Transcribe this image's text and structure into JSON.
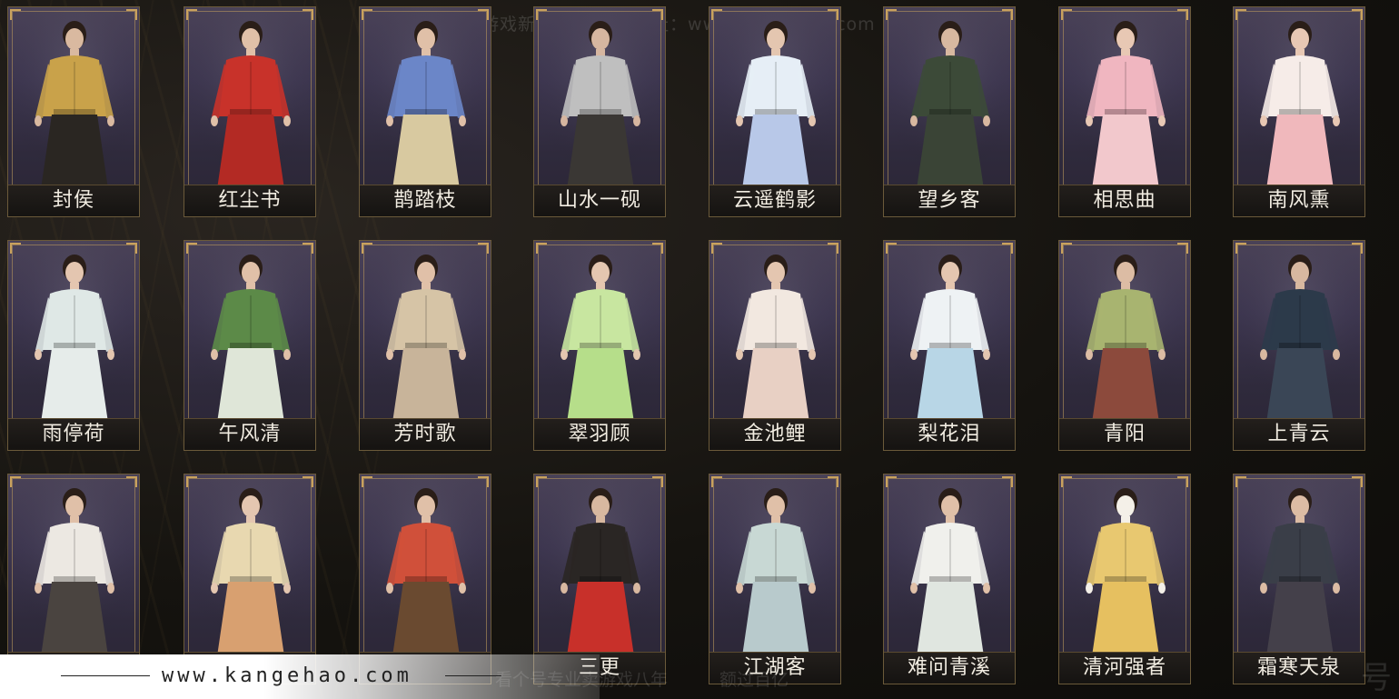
{
  "watermarks": {
    "top": "网易游戏新进宝 个号　网址：www.kangehao.com",
    "bottom": "看个号专业卖游戏八年　　　额过百亿",
    "logo_text": "号"
  },
  "banner": {
    "url": "www.kangehao.com"
  },
  "outfits": [
    {
      "name": "封侯",
      "top_color": "#c9a24a",
      "bottom_color": "#2a2622",
      "skin": "#d9b9a0"
    },
    {
      "name": "红尘书",
      "top_color": "#c8322a",
      "bottom_color": "#b32a24",
      "skin": "#e0c0a8"
    },
    {
      "name": "鹊踏枝",
      "top_color": "#6b86c8",
      "bottom_color": "#d8c9a0",
      "skin": "#e0c0a8"
    },
    {
      "name": "山水一砚",
      "top_color": "#bfbfbf",
      "bottom_color": "#3a3734",
      "skin": "#d6b6a0"
    },
    {
      "name": "云遥鹤影",
      "top_color": "#e6eef6",
      "bottom_color": "#b8c8e8",
      "skin": "#e4c6b0"
    },
    {
      "name": "望乡客",
      "top_color": "#3c4a38",
      "bottom_color": "#3a4436",
      "skin": "#d8b8a0"
    },
    {
      "name": "相思曲",
      "top_color": "#f0b6c0",
      "bottom_color": "#f2c8cc",
      "skin": "#e8c8b4"
    },
    {
      "name": "南风熏",
      "top_color": "#f6ece8",
      "bottom_color": "#f0b8bc",
      "skin": "#e8c8b4"
    },
    {
      "name": "雨停荷",
      "top_color": "#dfe8e6",
      "bottom_color": "#e6ecea",
      "skin": "#e4c6b0"
    },
    {
      "name": "午风清",
      "top_color": "#5c8a48",
      "bottom_color": "#dfe6d8",
      "skin": "#e0c0a8"
    },
    {
      "name": "芳时歌",
      "top_color": "#d6c4a6",
      "bottom_color": "#c8b49a",
      "skin": "#e0c0a8"
    },
    {
      "name": "翠羽顾",
      "top_color": "#c8e6a0",
      "bottom_color": "#b6de8a",
      "skin": "#e4c6b0"
    },
    {
      "name": "金池鲤",
      "top_color": "#f2e8e0",
      "bottom_color": "#e8d0c4",
      "skin": "#e4c6b0"
    },
    {
      "name": "梨花泪",
      "top_color": "#eef2f4",
      "bottom_color": "#b8d6e6",
      "skin": "#e4c6b0"
    },
    {
      "name": "青阳",
      "top_color": "#a8b470",
      "bottom_color": "#8c4a3c",
      "skin": "#dcbca4"
    },
    {
      "name": "上青云",
      "top_color": "#2c3a4a",
      "bottom_color": "#3a4656",
      "skin": "#d8b8a0"
    },
    {
      "name": "",
      "top_color": "#ece8e2",
      "bottom_color": "#4a4440",
      "skin": "#e0c0a8"
    },
    {
      "name": "",
      "top_color": "#e8d8b0",
      "bottom_color": "#d8a070",
      "skin": "#e4c6b0"
    },
    {
      "name": "",
      "top_color": "#d0503a",
      "bottom_color": "#6a4a30",
      "skin": "#e0c0a8"
    },
    {
      "name": "三更",
      "top_color": "#2a2624",
      "bottom_color": "#c8302a",
      "skin": "#d8b8a0"
    },
    {
      "name": "江湖客",
      "top_color": "#c8d8d4",
      "bottom_color": "#b8cacc",
      "skin": "#e0c0a8"
    },
    {
      "name": "难问青溪",
      "top_color": "#f0f0ec",
      "bottom_color": "#e0e6e0",
      "skin": "#e0c0a8"
    },
    {
      "name": "清河强者",
      "top_color": "#e8c870",
      "bottom_color": "#e6c060",
      "skin": "#f4f0e8"
    },
    {
      "name": "霜寒天泉",
      "top_color": "#3a3e48",
      "bottom_color": "#44404a",
      "skin": "#dcbca4"
    }
  ]
}
